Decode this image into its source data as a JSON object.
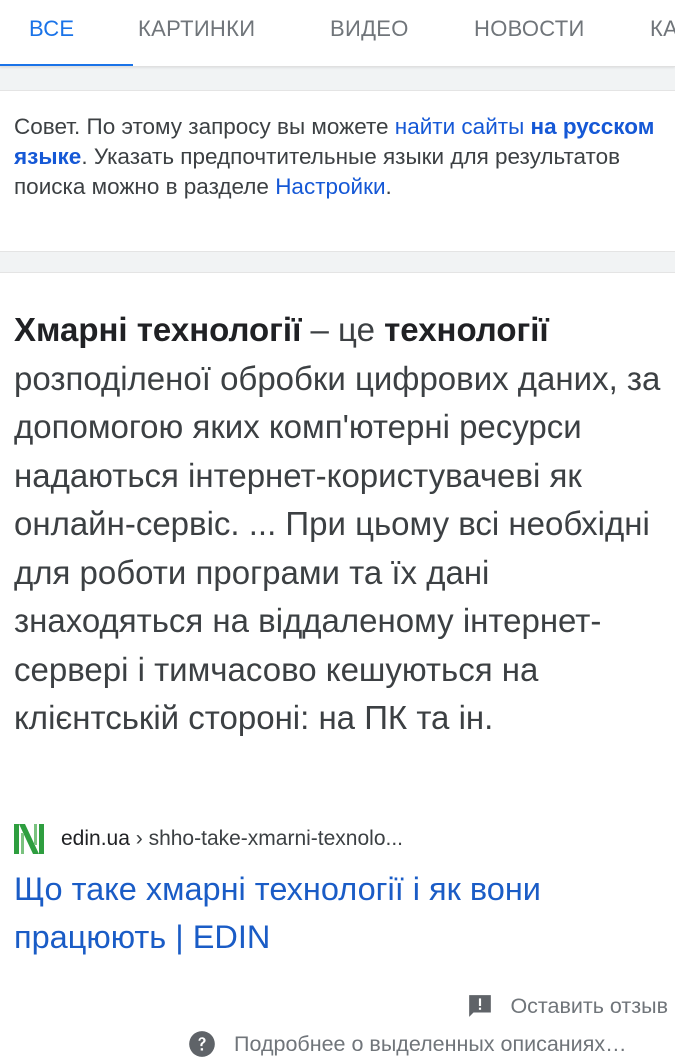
{
  "tabs": [
    {
      "label": "ВСЕ",
      "active": true
    },
    {
      "label": "КАРТИНКИ",
      "active": false
    },
    {
      "label": "ВИДЕО",
      "active": false
    },
    {
      "label": "НОВОСТИ",
      "active": false
    },
    {
      "label": "КАРТЫ",
      "active": false
    }
  ],
  "tip": {
    "prefix": "Совет. По этому запросу вы можете ",
    "link_text": "найти сайты ",
    "link_bold": "на русском языке",
    "middle": ". Указать предпочтительные языки для результатов поиска можно в разделе ",
    "settings_link": "Настройки",
    "suffix": "."
  },
  "snippet": {
    "term": "Хмарні технології",
    "dash": " – це ",
    "term2": "технології",
    "body": " розподіленої обробки цифрових даних, за допомогою яких комп'ютерні ресурси надаються інтернет-користувачеві як онлайн-сервіс. ... При цьому всі необхідні для роботи програми та їх дані знаходяться на віддаленому інтернет-сервері і тимчасово кешуються на клієнтській стороні: на ПК та ін."
  },
  "source": {
    "domain": "edin.ua",
    "separator": " › ",
    "path": "shho-take-xmarni-texnolo..."
  },
  "result_title": "Що таке хмарні технології і як вони працюють | EDIN",
  "feedback_label": "Оставить отзыв",
  "more_info_label": "Подробнее о выделенных описаниях…",
  "colors": {
    "accent": "#1a73e8",
    "link": "#1a5cc6",
    "favicon_green": "#2e9e3f"
  }
}
